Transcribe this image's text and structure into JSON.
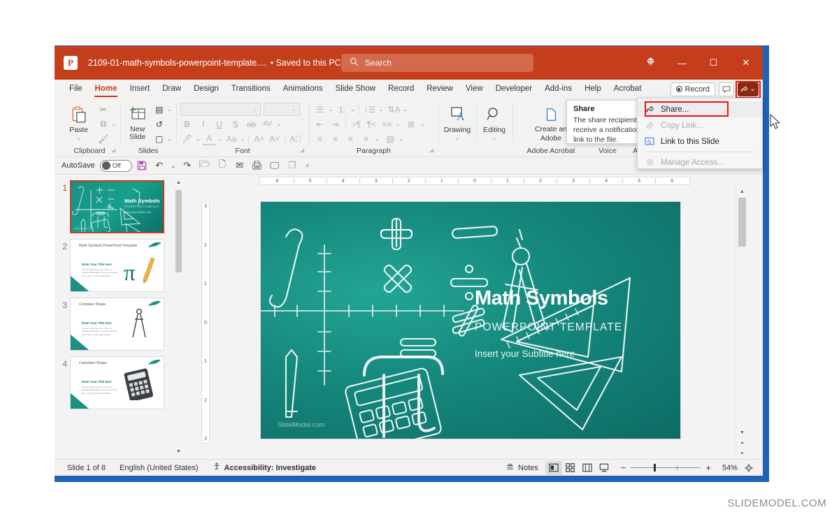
{
  "window": {
    "app_icon": "powerpoint-logo-icon",
    "title": "2109-01-math-symbols-powerpoint-template....",
    "saved_state": "• Saved to this PC",
    "saved_chevron": "⌄",
    "search_placeholder": "Search",
    "search_icon": "search-icon",
    "controls": {
      "diamond": "◈",
      "minimize": "—",
      "maximize": "☐",
      "close": "✕"
    }
  },
  "ribbon": {
    "tabs": [
      {
        "label": "File",
        "active": false
      },
      {
        "label": "Home",
        "active": true
      },
      {
        "label": "Insert",
        "active": false
      },
      {
        "label": "Draw",
        "active": false
      },
      {
        "label": "Design",
        "active": false
      },
      {
        "label": "Transitions",
        "active": false
      },
      {
        "label": "Animations",
        "active": false
      },
      {
        "label": "Slide Show",
        "active": false
      },
      {
        "label": "Record",
        "active": false
      },
      {
        "label": "Review",
        "active": false
      },
      {
        "label": "View",
        "active": false
      },
      {
        "label": "Developer",
        "active": false
      },
      {
        "label": "Add-ins",
        "active": false
      },
      {
        "label": "Help",
        "active": false
      },
      {
        "label": "Acrobat",
        "active": false
      }
    ],
    "record_button": "Record",
    "comments_icon": "comment-icon",
    "share_icon": "share-icon",
    "share_chevron": "⌄",
    "groups": [
      {
        "name": "Clipboard",
        "label": "Clipboard",
        "dialog_launcher": "⊿",
        "big_button": {
          "label": "Paste",
          "icon": "paste-icon",
          "chevron": "⌄"
        },
        "small_buttons": [
          "cut-icon",
          "copy-icon",
          "format-painter-icon"
        ]
      },
      {
        "name": "Slides",
        "label": "Slides",
        "big_button": {
          "label": "New Slide",
          "icon": "new-slide-icon",
          "chevron": "⌄"
        },
        "small_buttons": [
          "layout-icon",
          "reset-icon",
          "section-icon"
        ]
      },
      {
        "name": "Font",
        "label": "Font",
        "dialog_launcher": "⊿",
        "font_name_value": "",
        "font_size_value": "",
        "buttons": [
          "B",
          "I",
          "U",
          "S",
          "ab",
          "AV"
        ],
        "buttons_row2": [
          "text-highlight-icon",
          "font-color-icon",
          "Aa",
          "A^",
          "A˅",
          "clear-formatting-icon"
        ]
      },
      {
        "name": "Paragraph",
        "label": "Paragraph",
        "dialog_launcher": "⊿"
      },
      {
        "name": "Drawing",
        "label": "",
        "big_button": {
          "label": "Drawing",
          "icon": "drawing-icon",
          "chevron": "⌄"
        }
      },
      {
        "name": "Editing",
        "label": "",
        "big_button": {
          "label": "Editing",
          "icon": "magnifier-icon",
          "chevron": "⌄"
        }
      },
      {
        "name": "Adobe Acrobat",
        "label": "Adobe Acrobat",
        "big_button": {
          "label": "Create and Share Adobe PDF",
          "line1": "Create an",
          "line2": "Adobe",
          "icon": "acrobat-icon"
        }
      },
      {
        "name": "Voice",
        "label": "Voice"
      },
      {
        "name": "Add-ins",
        "label": "Add-ins"
      }
    ]
  },
  "quick_access": {
    "autosave_label": "AutoSave",
    "autosave_state": "Off",
    "icons": [
      "save-icon",
      "undo-icon",
      "undo-chevron",
      "redo-icon",
      "open-icon",
      "new-icon",
      "email-icon",
      "quick-print-icon",
      "start-slideshow-icon",
      "duplicate-icon",
      "customize-chevron-icon"
    ]
  },
  "thumbnails": [
    {
      "number": "1",
      "selected": true,
      "title": "Math Symbols",
      "subtitle": "POWERPOINT TEMPLATE",
      "subtitle2": "Insert your Subtitle here",
      "watermark": "SlideModel.com"
    },
    {
      "number": "2",
      "selected": false,
      "title": "Math Symbols PowerPoint Template",
      "heading": "Enter Your Title here",
      "body": "You can write here text. This is a sample placeholder. Your text will flow here. This is a text placeholder.",
      "art": "pi-and-pencil"
    },
    {
      "number": "3",
      "selected": false,
      "title": "Compass Shape",
      "heading": "Enter Your Title here",
      "body": "You can write here text. This is a sample placeholder. Your text will flow here. This is a text placeholder.",
      "art": "compass"
    },
    {
      "number": "4",
      "selected": false,
      "title": "Calculator Shape",
      "heading": "Enter Your Title here",
      "body": "You can write here text. This is a sample placeholder. Your text will flow here. This is a text placeholder.",
      "art": "calculator"
    }
  ],
  "rulers": {
    "horizontal": [
      "6",
      "5",
      "4",
      "3",
      "2",
      "1",
      "0",
      "1",
      "2",
      "3",
      "4",
      "5",
      "6"
    ],
    "vertical": [
      "3",
      "2",
      "1",
      "0",
      "1",
      "2",
      "3"
    ]
  },
  "slide": {
    "title": "Math Symbols",
    "subtitle": "POWERPOINT TEMPLATE",
    "subtitle2": "Insert your Subtitle here",
    "watermark": "SlideModel.com",
    "doodles": [
      "integral",
      "plus",
      "minus",
      "multiply",
      "divide",
      "not-equal",
      "equals",
      "pi",
      "compass",
      "triangle-ruler-large",
      "triangle-ruler-small",
      "pencil",
      "calculator",
      "axis-cross"
    ]
  },
  "share_menu": {
    "items": [
      {
        "label": "Share...",
        "icon": "share-icon",
        "enabled": true,
        "highlighted": true,
        "accel": "S"
      },
      {
        "label": "Copy Link...",
        "icon": "link-icon",
        "enabled": false,
        "accel": "C"
      },
      {
        "label": "Link to this Slide",
        "icon": "slide-link-icon",
        "enabled": true,
        "accel": "k"
      },
      {
        "label": "Manage Access...",
        "icon": "gear-icon",
        "enabled": false,
        "accel": "M"
      }
    ]
  },
  "tooltip": {
    "title": "Share",
    "body": "The share recipients you select will receive a notification email with a link to the file."
  },
  "status_bar": {
    "slide_count": "Slide 1 of 8",
    "language": "English (United States)",
    "accessibility_icon": "accessibility-icon",
    "accessibility": "Accessibility: Investigate",
    "notes_icon": "notes-icon",
    "notes_label": "Notes",
    "views": [
      {
        "name": "normal-view",
        "icon": "▣",
        "active": true
      },
      {
        "name": "slide-sorter-view",
        "icon": "⠿",
        "active": false
      },
      {
        "name": "reading-view",
        "icon": "▥",
        "active": false
      },
      {
        "name": "slideshow-view",
        "icon": "⎚",
        "active": false
      }
    ],
    "zoom_out": "−",
    "zoom_in": "+",
    "zoom_level": "54%",
    "fit_icon": "fit-slide-icon"
  },
  "page_watermark": "SLIDEMODEL.COM",
  "colors": {
    "brand_red": "#c43e1c",
    "share_dark": "#8a2b10",
    "highlight_red": "#ee1111",
    "desktop_blue": "#1f62b8",
    "slide_teal": "#16897e"
  }
}
